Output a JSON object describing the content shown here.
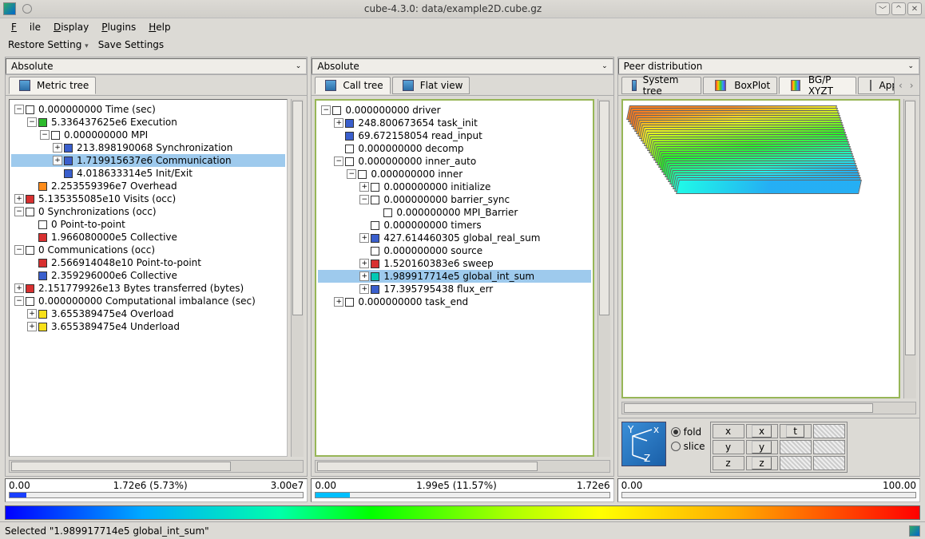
{
  "window": {
    "title": "cube-4.3.0: data/example2D.cube.gz"
  },
  "menu": {
    "file": "File",
    "display": "Display",
    "plugins": "Plugins",
    "help": "Help"
  },
  "toolbar": {
    "restore": "Restore Setting",
    "save": "Save Settings"
  },
  "panels": {
    "metric": {
      "selector": "Absolute",
      "tab": "Metric tree"
    },
    "call": {
      "selector": "Absolute",
      "tabs": {
        "calltree": "Call tree",
        "flatview": "Flat view"
      }
    },
    "system": {
      "selector": "Peer distribution",
      "tabs": {
        "systree": "System tree",
        "boxplot": "BoxPlot",
        "xyzt": "BG/P XYZT",
        "app": "App"
      }
    }
  },
  "colors": {
    "white": "#ffffff",
    "blue": "#3a5fcd",
    "red": "#d83030",
    "orange": "#ff8c1a",
    "cyan": "#00c8b4",
    "yellow": "#f8e018",
    "green": "#2dbb2d",
    "mid": "#b8e018"
  },
  "metric_tree": [
    {
      "d": 0,
      "e": "-",
      "c": "white",
      "t": "0.000000000 Time (sec)"
    },
    {
      "d": 1,
      "e": "-",
      "c": "green",
      "t": "5.336437625e6 Execution"
    },
    {
      "d": 2,
      "e": "-",
      "c": "white",
      "t": "0.000000000 MPI"
    },
    {
      "d": 3,
      "e": "+",
      "c": "blue",
      "t": "213.898190068 Synchronization"
    },
    {
      "d": 3,
      "e": "+",
      "c": "blue",
      "t": "1.719915637e6 Communication",
      "sel": true
    },
    {
      "d": 3,
      "e": "",
      "c": "blue",
      "t": "4.018633314e5 Init/Exit"
    },
    {
      "d": 1,
      "e": "",
      "c": "orange",
      "t": "2.253559396e7 Overhead"
    },
    {
      "d": 0,
      "e": "+",
      "c": "red",
      "t": "5.135355085e10 Visits (occ)"
    },
    {
      "d": 0,
      "e": "-",
      "c": "white",
      "t": "0 Synchronizations (occ)"
    },
    {
      "d": 1,
      "e": "",
      "c": "white",
      "t": "0 Point-to-point"
    },
    {
      "d": 1,
      "e": "",
      "c": "red",
      "t": "1.966080000e5 Collective"
    },
    {
      "d": 0,
      "e": "-",
      "c": "white",
      "t": "0 Communications (occ)"
    },
    {
      "d": 1,
      "e": "",
      "c": "red",
      "t": "2.566914048e10 Point-to-point"
    },
    {
      "d": 1,
      "e": "",
      "c": "blue",
      "t": "2.359296000e6 Collective"
    },
    {
      "d": 0,
      "e": "+",
      "c": "red",
      "t": "2.151779926e13 Bytes transferred (bytes)"
    },
    {
      "d": 0,
      "e": "-",
      "c": "white",
      "t": "0.000000000 Computational imbalance (sec)"
    },
    {
      "d": 1,
      "e": "+",
      "c": "yellow",
      "t": "3.655389475e4 Overload"
    },
    {
      "d": 1,
      "e": "+",
      "c": "yellow",
      "t": "3.655389475e4 Underload"
    }
  ],
  "call_tree": [
    {
      "d": 0,
      "e": "-",
      "c": "white",
      "t": "0.000000000 driver"
    },
    {
      "d": 1,
      "e": "+",
      "c": "blue",
      "t": "248.800673654 task_init"
    },
    {
      "d": 1,
      "e": "",
      "c": "blue",
      "t": "69.672158054 read_input"
    },
    {
      "d": 1,
      "e": "",
      "c": "white",
      "t": "0.000000000 decomp"
    },
    {
      "d": 1,
      "e": "-",
      "c": "white",
      "t": "0.000000000 inner_auto"
    },
    {
      "d": 2,
      "e": "-",
      "c": "white",
      "t": "0.000000000 inner"
    },
    {
      "d": 3,
      "e": "+",
      "c": "white",
      "t": "0.000000000 initialize"
    },
    {
      "d": 3,
      "e": "-",
      "c": "white",
      "t": "0.000000000 barrier_sync"
    },
    {
      "d": 4,
      "e": "",
      "c": "white",
      "t": "0.000000000 MPI_Barrier"
    },
    {
      "d": 3,
      "e": "",
      "c": "white",
      "t": "0.000000000 timers"
    },
    {
      "d": 3,
      "e": "+",
      "c": "blue",
      "t": "427.614460305 global_real_sum"
    },
    {
      "d": 3,
      "e": "",
      "c": "white",
      "t": "0.000000000 source"
    },
    {
      "d": 3,
      "e": "+",
      "c": "red",
      "t": "1.520160383e6 sweep"
    },
    {
      "d": 3,
      "e": "+",
      "c": "cyan",
      "t": "1.989917714e5 global_int_sum",
      "sel": true
    },
    {
      "d": 3,
      "e": "+",
      "c": "blue",
      "t": "17.395795438 flux_err"
    },
    {
      "d": 1,
      "e": "+",
      "c": "white",
      "t": "0.000000000 task_end"
    }
  ],
  "controls": {
    "fold": "fold",
    "slice": "slice",
    "axes": [
      "x",
      "y",
      "z"
    ],
    "heads": [
      "x",
      "t"
    ],
    "btns": {
      "x": "x",
      "t": "t",
      "y": "y",
      "z": "z"
    }
  },
  "scales": {
    "metric": {
      "lo": "0.00",
      "mid": "1.72e6 (5.73%)",
      "hi": "3.00e7",
      "pct": 5.73,
      "color": "#1a3fff"
    },
    "call": {
      "lo": "0.00",
      "mid": "1.99e5 (11.57%)",
      "hi": "1.72e6",
      "pct": 11.57,
      "color": "#00bfff"
    },
    "system": {
      "lo": "0.00",
      "mid": "",
      "hi": "100.00",
      "pct": 0,
      "color": "#888"
    }
  },
  "status": {
    "text": "Selected \"1.989917714e5 global_int_sum\""
  }
}
